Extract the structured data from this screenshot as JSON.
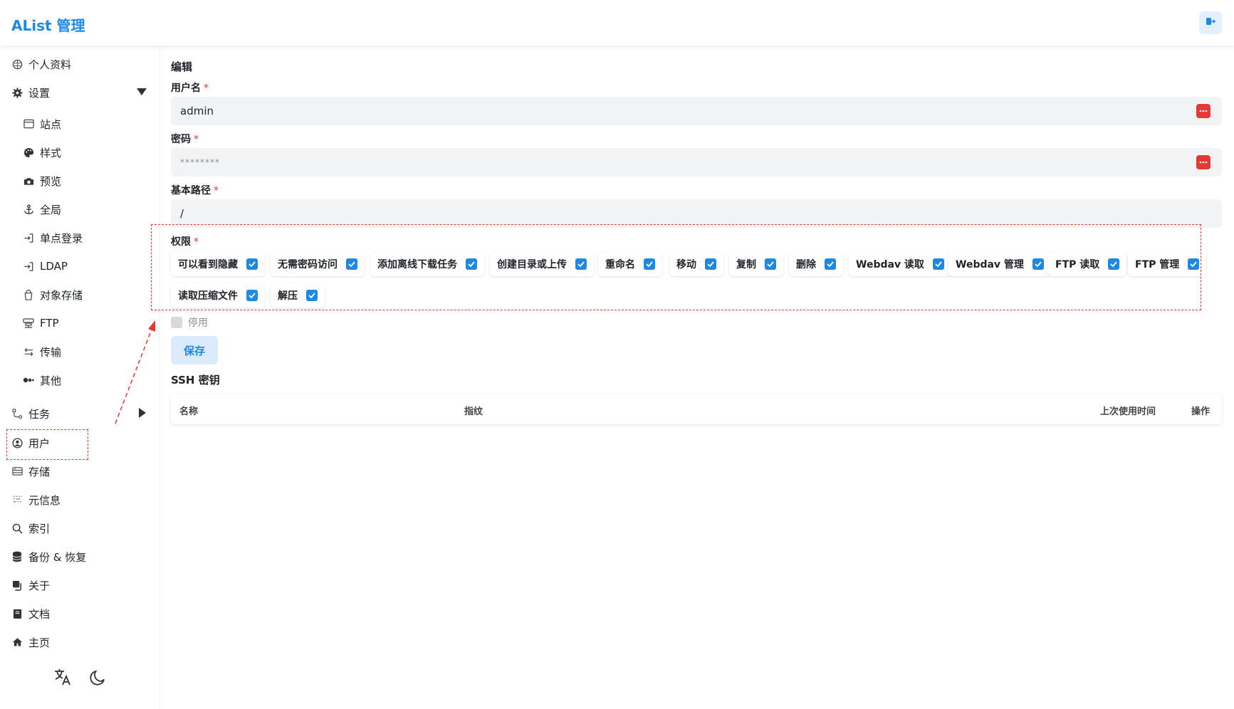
{
  "header": {
    "brand": "AList 管理",
    "logout_icon": "logout-icon"
  },
  "sidebar": {
    "items": [
      {
        "label": "个人资料",
        "icon": "profile-icon"
      },
      {
        "label": "设置",
        "icon": "gear-icon"
      },
      {
        "label": "站点",
        "icon": "window-icon"
      },
      {
        "label": "样式",
        "icon": "palette-icon"
      },
      {
        "label": "预览",
        "icon": "camera-icon"
      },
      {
        "label": "全局",
        "icon": "anchor-icon"
      },
      {
        "label": "单点登录",
        "icon": "login-icon"
      },
      {
        "label": "LDAP",
        "icon": "login-icon"
      },
      {
        "label": "对象存储",
        "icon": "bucket-icon"
      },
      {
        "label": "FTP",
        "icon": "server-icon"
      },
      {
        "label": "传输",
        "icon": "transfer-icon"
      },
      {
        "label": "其他",
        "icon": "dots-icon"
      },
      {
        "label": "任务",
        "icon": "flow-icon"
      },
      {
        "label": "用户",
        "icon": "user-circle-icon"
      },
      {
        "label": "存储",
        "icon": "storage-icon"
      },
      {
        "label": "元信息",
        "icon": "meta-icon"
      },
      {
        "label": "索引",
        "icon": "search-icon"
      },
      {
        "label": "备份 & 恢复",
        "icon": "database-icon"
      },
      {
        "label": "关于",
        "icon": "copy-icon"
      },
      {
        "label": "文档",
        "icon": "book-icon"
      },
      {
        "label": "主页",
        "icon": "home-icon"
      }
    ],
    "bottom_icons": [
      "translate-icon",
      "moon-icon"
    ]
  },
  "form": {
    "title": "编辑",
    "username_label": "用户名",
    "username_value": "admin",
    "password_label": "密码",
    "password_value": "********",
    "base_path_label": "基本路径",
    "base_path_value": "/",
    "permissions_label": "权限",
    "required_mark": "*",
    "permissions": [
      {
        "label": "可以看到隐藏",
        "checked": true
      },
      {
        "label": "无需密码访问",
        "checked": true
      },
      {
        "label": "添加离线下载任务",
        "checked": true
      },
      {
        "label": "创建目录或上传",
        "checked": true
      },
      {
        "label": "重命名",
        "checked": true
      },
      {
        "label": "移动",
        "checked": true
      },
      {
        "label": "复制",
        "checked": true
      },
      {
        "label": "删除",
        "checked": true
      },
      {
        "label": "Webdav 读取",
        "checked": true
      },
      {
        "label": "Webdav 管理",
        "checked": true
      },
      {
        "label": "FTP 读取",
        "checked": true
      },
      {
        "label": "FTP 管理",
        "checked": true
      },
      {
        "label": "读取压缩文件",
        "checked": true
      },
      {
        "label": "解压",
        "checked": true
      }
    ],
    "disable_label": "停用",
    "disable_checked": false,
    "save_label": "保存"
  },
  "ssh": {
    "title": "SSH 密钥",
    "columns": [
      "名称",
      "指纹",
      "上次使用时间",
      "操作"
    ]
  },
  "colors": {
    "accent": "#1e88e5",
    "danger": "#e53935",
    "annotation": "#e53935"
  }
}
